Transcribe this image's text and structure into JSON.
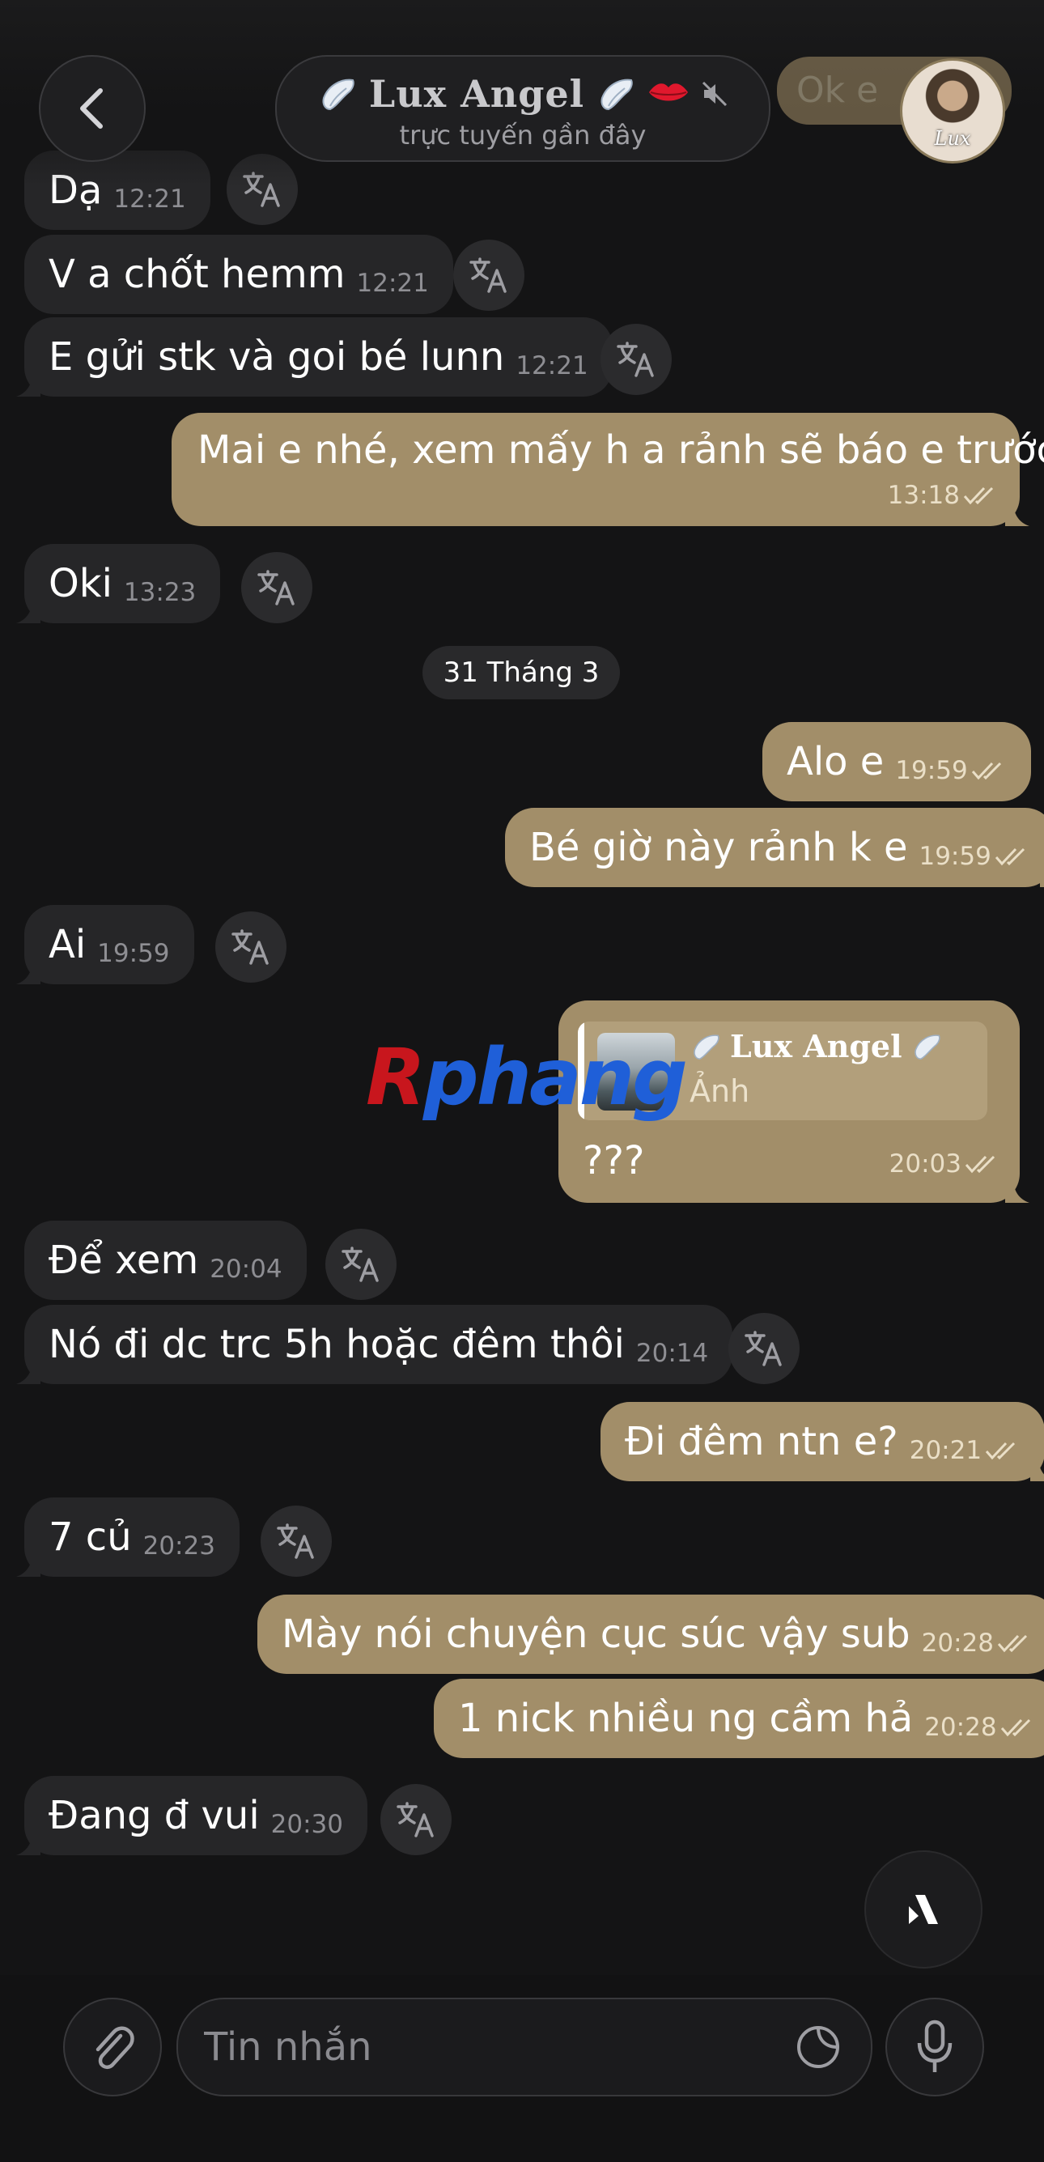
{
  "header": {
    "back_label": "",
    "title": "Lux Angel",
    "subtitle": "trực tuyến gần đây",
    "partial_prev_message": "Ok e",
    "avatar_logo": "Lux"
  },
  "date_separator": "31 Tháng 3",
  "messages": [
    {
      "dir": "in",
      "text": "Dạ",
      "time": "12:21"
    },
    {
      "dir": "in",
      "text": "V a chốt hemm",
      "time": "12:21"
    },
    {
      "dir": "in",
      "text": "E gửi stk và goi bé lunn",
      "time": "12:21"
    },
    {
      "dir": "out",
      "text": "Mai e nhé, xem mấy h a rảnh sẽ báo e trước",
      "time": "13:18"
    },
    {
      "dir": "in",
      "text": "Oki",
      "time": "13:23"
    },
    {
      "dir": "out",
      "text": "Alo e",
      "time": "19:59"
    },
    {
      "dir": "out",
      "text": "Bé giờ này rảnh k e",
      "time": "19:59"
    },
    {
      "dir": "in",
      "text": "Ai",
      "time": "19:59"
    },
    {
      "dir": "out",
      "text": "???",
      "time": "20:03",
      "reply_to": {
        "name": "Lux Angel",
        "preview": "Ảnh"
      }
    },
    {
      "dir": "in",
      "text": "Để xem",
      "time": "20:04"
    },
    {
      "dir": "in",
      "text": "Nó đi dc trc 5h hoặc đêm thôi",
      "time": "20:14"
    },
    {
      "dir": "out",
      "text": "Đi đêm ntn e?",
      "time": "20:21"
    },
    {
      "dir": "in",
      "text": "7 củ",
      "time": "20:23"
    },
    {
      "dir": "out",
      "text": "Mày nói chuyện cục súc vậy sub",
      "time": "20:28"
    },
    {
      "dir": "out",
      "text": "1 nick nhiều ng cầm hả",
      "time": "20:28"
    },
    {
      "dir": "in",
      "text": "Đang đ vui",
      "time": "20:30"
    }
  ],
  "composer": {
    "placeholder": "Tin nhắn",
    "attach_icon": "paperclip-icon",
    "sticker_icon": "sticker-icon",
    "mic_icon": "microphone-icon"
  },
  "watermark": {
    "first": "R",
    "rest": "phang"
  },
  "colors": {
    "background": "#141415",
    "incoming_bubble": "#262628",
    "outgoing_bubble": "#a28e69",
    "meta_text": "#8e8e93"
  }
}
